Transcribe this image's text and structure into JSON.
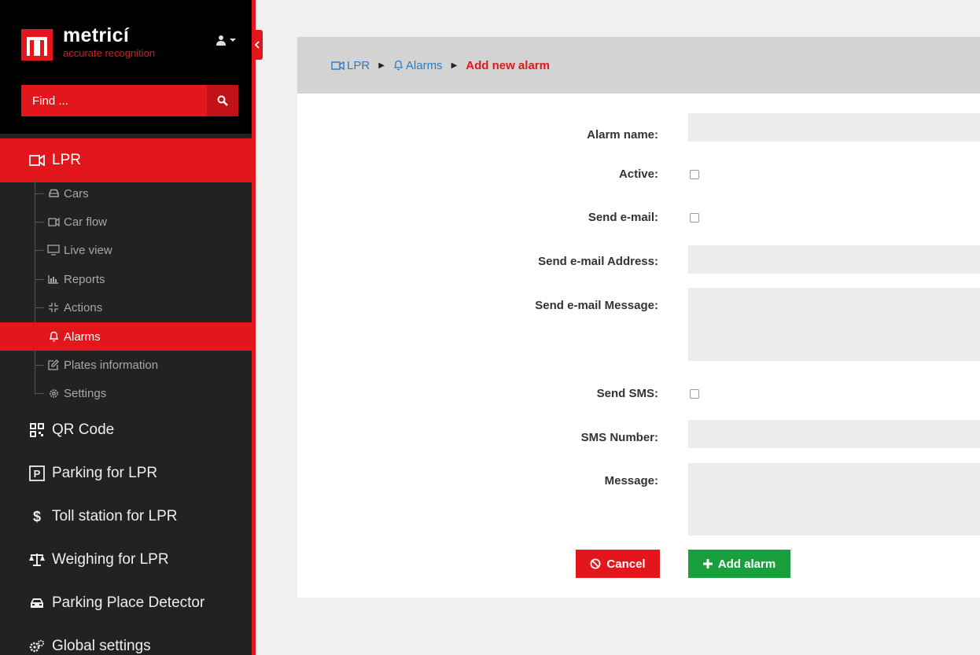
{
  "brand": {
    "name": "metricí",
    "tagline": "accurate recognition"
  },
  "search": {
    "placeholder": "Find ..."
  },
  "sidebar": {
    "lpr_label": "LPR",
    "sub_items": [
      {
        "label": "Cars",
        "icon": "car-icon"
      },
      {
        "label": "Car flow",
        "icon": "video-camera-icon"
      },
      {
        "label": "Live view",
        "icon": "monitor-icon"
      },
      {
        "label": "Reports",
        "icon": "bar-chart-icon"
      },
      {
        "label": "Actions",
        "icon": "compress-icon"
      },
      {
        "label": "Alarms",
        "icon": "bell-icon"
      },
      {
        "label": "Plates information",
        "icon": "edit-icon"
      },
      {
        "label": "Settings",
        "icon": "gear-icon"
      }
    ],
    "main_items": [
      {
        "label": "QR Code",
        "icon": "qr-code-icon"
      },
      {
        "label": "Parking for LPR",
        "icon": "parking-icon"
      },
      {
        "label": "Toll station for LPR",
        "icon": "dollar-icon"
      },
      {
        "label": "Weighing for LPR",
        "icon": "scale-icon"
      },
      {
        "label": "Parking Place Detector",
        "icon": "car-icon"
      },
      {
        "label": "Global settings",
        "icon": "gears-icon"
      }
    ]
  },
  "breadcrumb": {
    "item1": "LPR",
    "item2": "Alarms",
    "current": "Add new alarm"
  },
  "form": {
    "alarm_name_label": "Alarm name:",
    "active_label": "Active:",
    "send_email_label": "Send e-mail:",
    "email_address_label": "Send e-mail Address:",
    "email_message_label": "Send e-mail Message:",
    "send_sms_label": "Send SMS:",
    "sms_number_label": "SMS Number:",
    "message_label": "Message:",
    "alarm_name_value": "",
    "email_address_value": "",
    "email_message_value": "",
    "sms_number_value": "",
    "message_value": "",
    "active_checked": false,
    "send_email_checked": false,
    "send_sms_checked": false
  },
  "buttons": {
    "cancel": "Cancel",
    "add": "Add alarm"
  },
  "colors": {
    "accent": "#e3171b",
    "success": "#1a9f3d",
    "link": "#2f7bbf",
    "sidebar_bg": "#222222"
  }
}
